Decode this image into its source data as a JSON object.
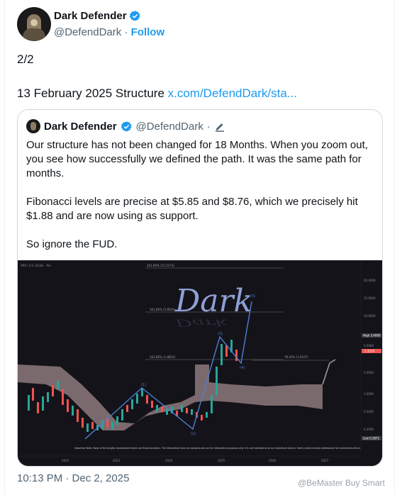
{
  "author": {
    "display_name": "Dark Defender",
    "handle": "@DefendDark",
    "separator": "·",
    "follow_label": "Follow"
  },
  "tweet": {
    "line1": "2/2",
    "line2_prefix": "13 February 2025 Structure ",
    "line2_link": "x.com/DefendDark/sta..."
  },
  "quote": {
    "display_name": "Dark Defender",
    "handle": "@DefendDark",
    "separator": "·",
    "paragraphs": [
      "Our structure has not been changed for 18 Months. When you zoom out, you see how successfully we defined the path. It was the same path for months.",
      "Fibonacci levels are precise at $5.85 and $8.76, which we precisely hit $1.88 and are now using as support.",
      "So ignore the FUD."
    ],
    "chart": {
      "title": "XRP / U.S. Dollar · Pol",
      "watermark_text": "Dark",
      "fib_labels": [
        "261.80% (15.2373)",
        "161.80% (5.8503)",
        "161.80% (1.8810)",
        "78.20% (1.9107)"
      ],
      "wave_labels": [
        "(1)",
        "(2)",
        "(3)",
        "(4)",
        "(5)"
      ],
      "price_labels": [
        "20.0000",
        "15.0000",
        "10.0000",
        "5.0000",
        "2.0000",
        "1.0000",
        "0.5000",
        "0.2000"
      ],
      "high_label": "High 3.4000",
      "current_price_label": "2.3310",
      "low_label": "Low 0.2871",
      "time_labels": [
        "2022",
        "2023",
        "2024",
        "2025",
        "2026",
        "2027"
      ],
      "disclaimer": "Important Note: None of the targets represented herein are financial advice. The information here are opinions and are for informative purposes only. It is not intended to be an investment advice. Seek a duly licensed professional for investment advice."
    }
  },
  "footer": {
    "timestamp": "10:13 PM · Dec 2, 2025",
    "watermark": "@BeMaster Buy Smart"
  },
  "colors": {
    "accent": "#1d9bf0",
    "chart_bg": "#141319",
    "cloud": "#8d7a7c",
    "wave_line": "#4a7fd6",
    "candle_up": "#26a69a",
    "candle_down": "#ef5350"
  }
}
